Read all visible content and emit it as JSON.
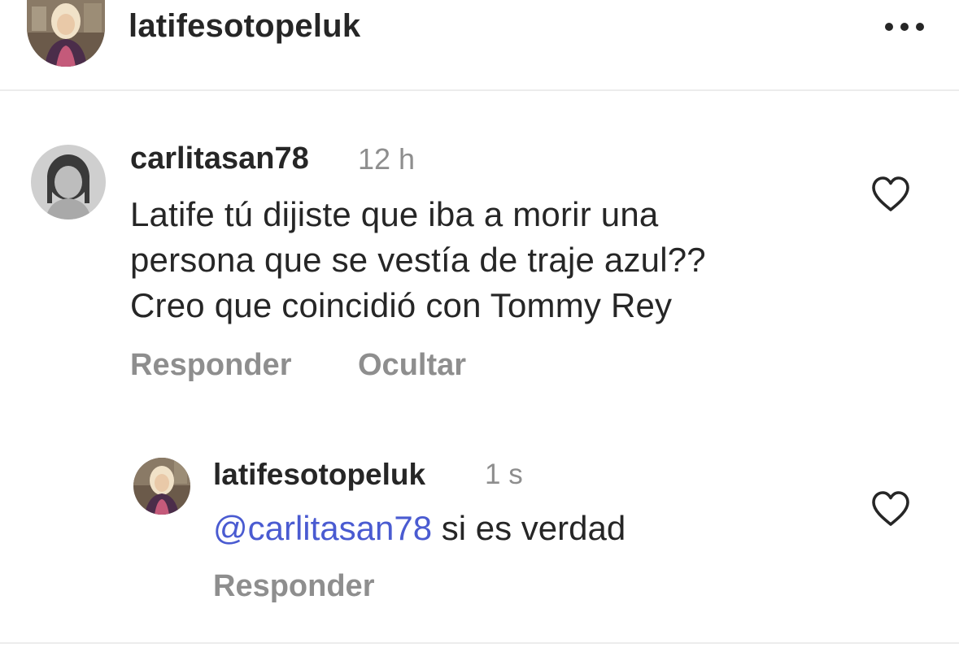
{
  "header": {
    "username": "latifesotopeluk",
    "more_icon": "more-horizontal-icon"
  },
  "comment": {
    "username": "carlitasan78",
    "time": "12 h",
    "lines": [
      "Latife tú dijiste que iba a morir una",
      "persona que se vestía de traje azul??",
      "Creo que coincidió con Tommy Rey"
    ],
    "actions": {
      "reply": "Responder",
      "hide": "Ocultar"
    },
    "like_icon": "heart-outline-icon"
  },
  "reply": {
    "username": "latifesotopeluk",
    "time": "1 s",
    "mention": "@carlitasan78",
    "text": " si es verdad",
    "actions": {
      "reply": "Responder"
    },
    "like_icon": "heart-outline-icon"
  },
  "colors": {
    "text": "#262626",
    "muted": "#8e8e8e",
    "mention": "#4a5bd1",
    "divider": "#ececec"
  }
}
